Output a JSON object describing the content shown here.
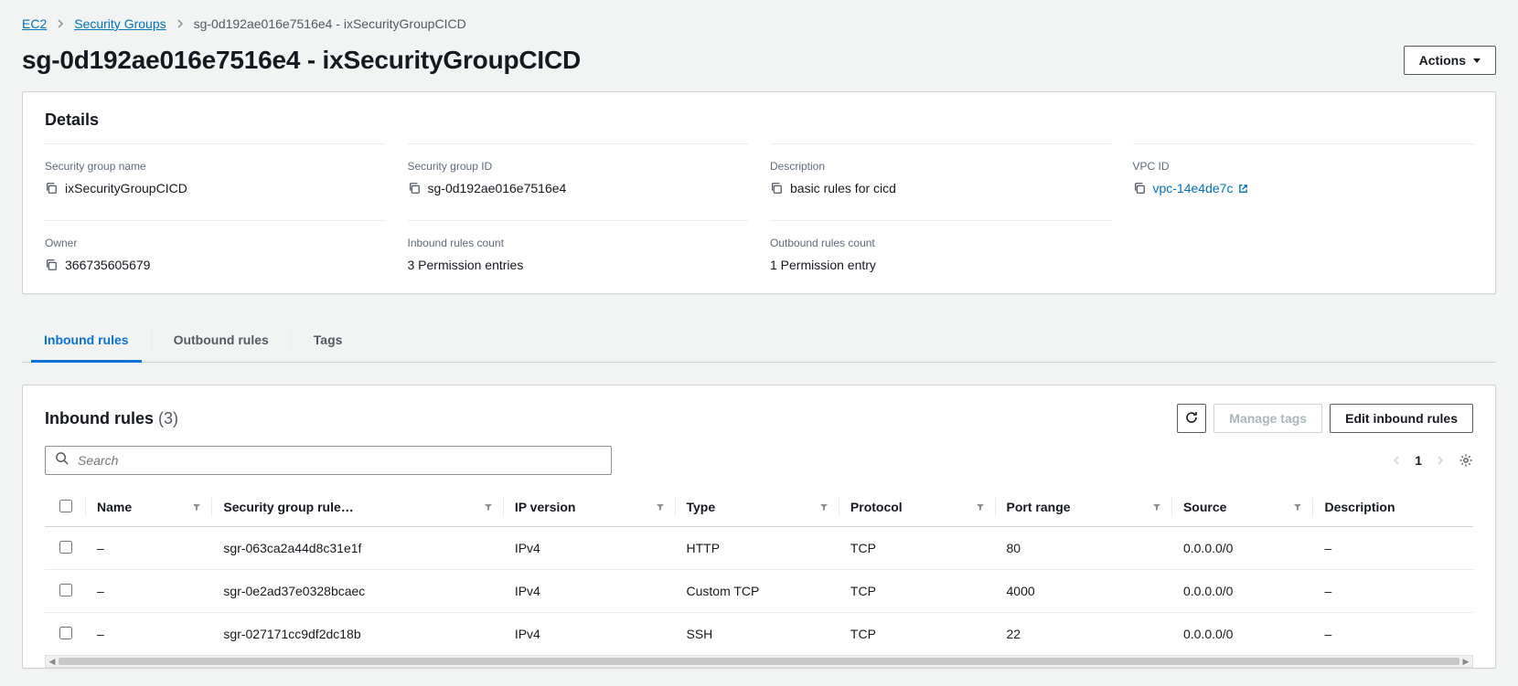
{
  "breadcrumb": {
    "items": [
      {
        "label": "EC2",
        "link": true
      },
      {
        "label": "Security Groups",
        "link": true
      },
      {
        "label": "sg-0d192ae016e7516e4 - ixSecurityGroupCICD",
        "link": false
      }
    ]
  },
  "page": {
    "title": "sg-0d192ae016e7516e4 - ixSecurityGroupCICD",
    "actions_label": "Actions"
  },
  "details": {
    "heading": "Details",
    "fields": {
      "sg_name": {
        "label": "Security group name",
        "value": "ixSecurityGroupCICD",
        "copy": true
      },
      "sg_id": {
        "label": "Security group ID",
        "value": "sg-0d192ae016e7516e4",
        "copy": true
      },
      "desc": {
        "label": "Description",
        "value": "basic rules for cicd",
        "copy": true
      },
      "vpc": {
        "label": "VPC ID",
        "value": "vpc-14e4de7c",
        "copy": true,
        "link": true
      },
      "owner": {
        "label": "Owner",
        "value": "366735605679",
        "copy": true
      },
      "inbound": {
        "label": "Inbound rules count",
        "value": "3 Permission entries"
      },
      "outbound": {
        "label": "Outbound rules count",
        "value": "1 Permission entry"
      }
    }
  },
  "tabs": {
    "items": [
      {
        "id": "inbound",
        "label": "Inbound rules",
        "active": true
      },
      {
        "id": "outbound",
        "label": "Outbound rules",
        "active": false
      },
      {
        "id": "tags",
        "label": "Tags",
        "active": false
      }
    ]
  },
  "rules": {
    "title": "Inbound rules",
    "count_display": "(3)",
    "buttons": {
      "refresh": "Refresh",
      "manage_tags": "Manage tags",
      "edit": "Edit inbound rules"
    },
    "search_placeholder": "Search",
    "pager": {
      "page": "1"
    },
    "columns": [
      "Name",
      "Security group rule…",
      "IP version",
      "Type",
      "Protocol",
      "Port range",
      "Source",
      "Description"
    ],
    "rows": [
      {
        "name": "–",
        "rule_id": "sgr-063ca2a44d8c31e1f",
        "ip": "IPv4",
        "type": "HTTP",
        "proto": "TCP",
        "port": "80",
        "source": "0.0.0.0/0",
        "desc": "–"
      },
      {
        "name": "–",
        "rule_id": "sgr-0e2ad37e0328bcaec",
        "ip": "IPv4",
        "type": "Custom TCP",
        "proto": "TCP",
        "port": "4000",
        "source": "0.0.0.0/0",
        "desc": "–"
      },
      {
        "name": "–",
        "rule_id": "sgr-027171cc9df2dc18b",
        "ip": "IPv4",
        "type": "SSH",
        "proto": "TCP",
        "port": "22",
        "source": "0.0.0.0/0",
        "desc": "–"
      }
    ]
  }
}
